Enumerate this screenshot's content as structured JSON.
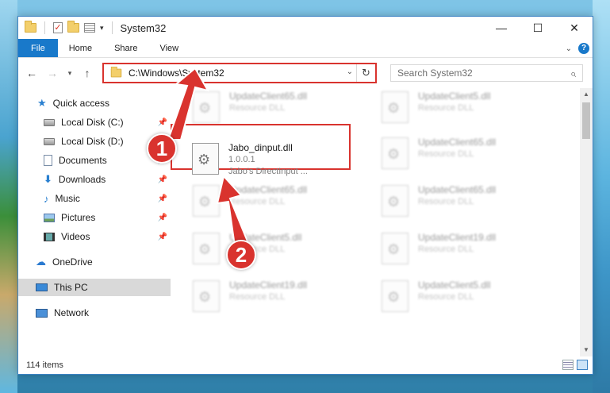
{
  "window": {
    "title": "System32"
  },
  "ribbon": {
    "tabs": [
      "File",
      "Home",
      "Share",
      "View"
    ]
  },
  "address": {
    "path": "C:\\Windows\\System32"
  },
  "search": {
    "placeholder": "Search System32"
  },
  "sidebar": {
    "items": [
      {
        "label": "Quick access",
        "icon": "star-icon",
        "pinned": false
      },
      {
        "label": "Local Disk (C:)",
        "icon": "drive-icon",
        "pinned": true
      },
      {
        "label": "Local Disk (D:)",
        "icon": "drive-icon",
        "pinned": false
      },
      {
        "label": "Documents",
        "icon": "document-icon",
        "pinned": true
      },
      {
        "label": "Downloads",
        "icon": "download-icon",
        "pinned": true
      },
      {
        "label": "Music",
        "icon": "music-icon",
        "pinned": true
      },
      {
        "label": "Pictures",
        "icon": "pictures-icon",
        "pinned": true
      },
      {
        "label": "Videos",
        "icon": "videos-icon",
        "pinned": true
      },
      {
        "label": "OneDrive",
        "icon": "cloud-icon",
        "pinned": false
      },
      {
        "label": "This PC",
        "icon": "computer-icon",
        "pinned": false,
        "selected": true
      },
      {
        "label": "Network",
        "icon": "network-icon",
        "pinned": false
      }
    ]
  },
  "files": {
    "highlighted": {
      "name": "Jabo_dinput.dll",
      "version": "1.0.0.1",
      "description": "Jabo's DirectInput ..."
    },
    "blurred": [
      {
        "name": "UpdateClient65.dll",
        "type": "Resource DLL"
      },
      {
        "name": "UpdateClient5.dll",
        "type": "Resource DLL"
      },
      {
        "name": "UpdateClient65.dll",
        "type": "Resource DLL"
      },
      {
        "name": "UpdateClient65.dll",
        "type": "Resource DLL"
      },
      {
        "name": "UpdateClient65.dll",
        "type": "Resource DLL"
      },
      {
        "name": "UpdateClient5.dll",
        "type": "Resource DLL"
      },
      {
        "name": "UpdateClient19.dll",
        "type": "Resource DLL"
      },
      {
        "name": "UpdateClient19.dll",
        "type": "Resource DLL"
      },
      {
        "name": "UpdateClient5.dll",
        "type": "Resource DLL"
      }
    ]
  },
  "status": {
    "item_count": "114 items"
  },
  "annotations": {
    "step1": "1",
    "step2": "2",
    "color": "#d9332e"
  }
}
